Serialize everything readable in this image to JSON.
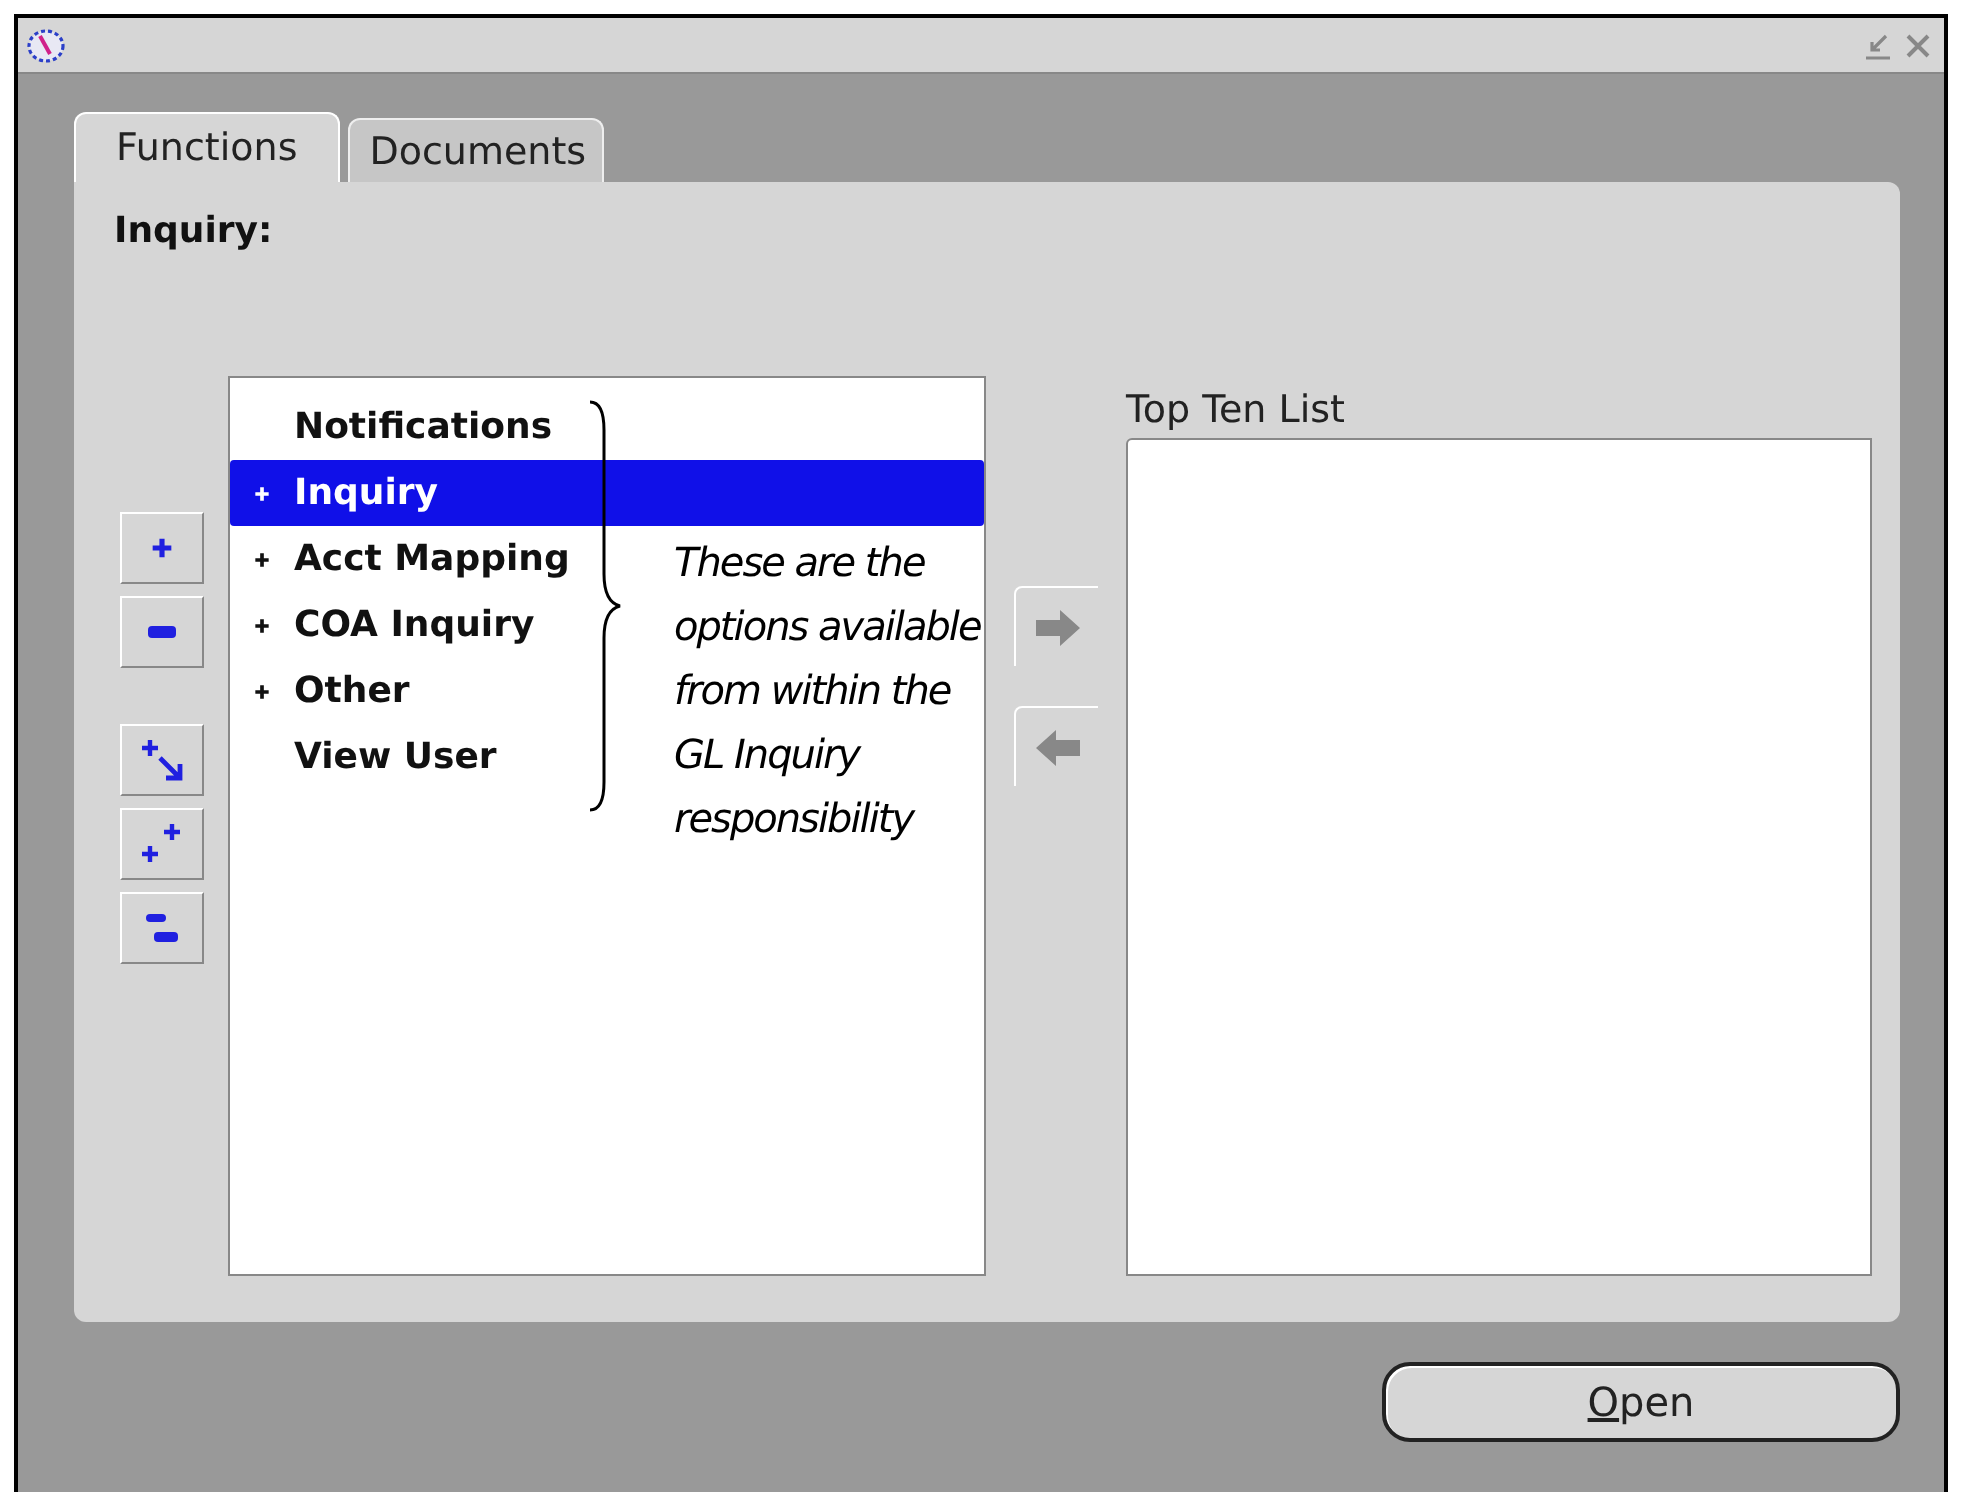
{
  "tabs": [
    {
      "label": "Functions",
      "selected": true
    },
    {
      "label": "Documents",
      "selected": false
    }
  ],
  "section_label": "Inquiry:",
  "tree": [
    {
      "label": "Notifications",
      "expandable": false,
      "selected": false
    },
    {
      "label": "Inquiry",
      "expandable": true,
      "selected": true
    },
    {
      "label": "Acct Mapping",
      "expandable": true,
      "selected": false
    },
    {
      "label": "COA Inquiry",
      "expandable": true,
      "selected": false
    },
    {
      "label": "Other",
      "expandable": true,
      "selected": false
    },
    {
      "label": "View User",
      "expandable": false,
      "selected": false
    }
  ],
  "annotation": "These are the options available from within the GL Inquiry responsibility",
  "top_ten": {
    "label": "Top Ten List"
  },
  "button": {
    "label": "Open"
  }
}
